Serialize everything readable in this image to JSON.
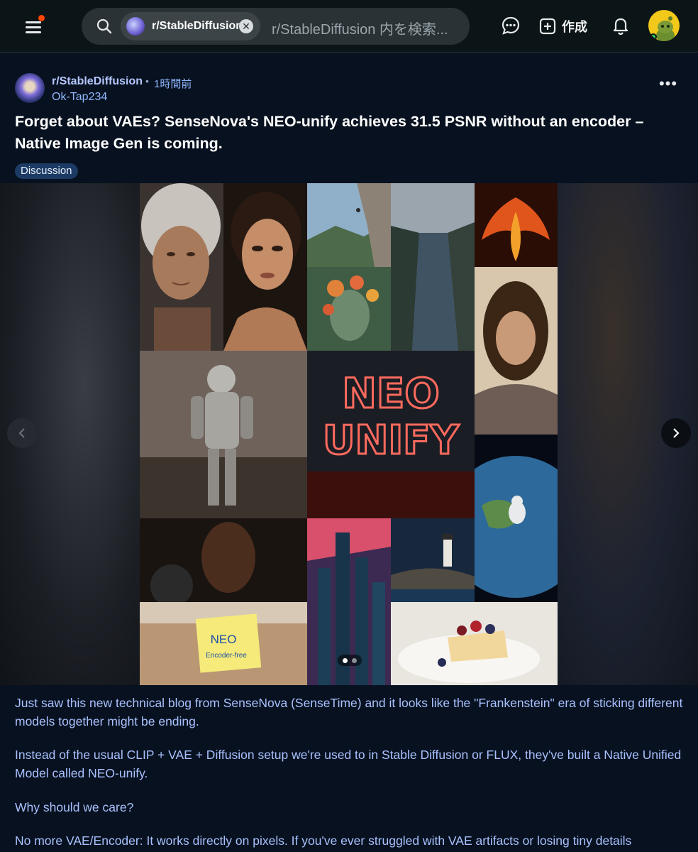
{
  "topbar": {
    "search_chip": "r/StableDiffusion",
    "search_placeholder": "r/StableDiffusion 内を検索...",
    "create_label": "作成",
    "icons": [
      "menu-icon",
      "search-icon",
      "close-icon",
      "chat-icon",
      "plus-icon",
      "bell-icon"
    ],
    "accent": "#ff4500"
  },
  "post": {
    "subreddit": "r/StableDiffusion",
    "separator": "•",
    "time": "1時間前",
    "author": "Ok-Tap234",
    "more": "•••",
    "title": "Forget about VAEs? SenseNova's NEO-unify achieves 31.5 PSNR without an encoder – Native Image Gen is coming.",
    "flair": "Discussion"
  },
  "gallery": {
    "neon_line1": "NEO",
    "neon_line2": "UNIFY",
    "note_line1": "NEO",
    "note_line2": "Encoder-free",
    "dots_total": 2,
    "dots_active": 1
  },
  "body": {
    "p1": "Just saw this new technical blog from SenseNova (SenseTime) and it looks like the \"Frankenstein\" era of sticking different models together might be ending.",
    "p2": "Instead of the usual CLIP + VAE + Diffusion setup we're used to in Stable Diffusion or FLUX, they've built a Native Unified Model called NEO-unify.",
    "p3": "Why should we care?",
    "p4": "No more VAE/Encoder: It works directly on pixels. If you've ever struggled with VAE artifacts or losing tiny details"
  }
}
